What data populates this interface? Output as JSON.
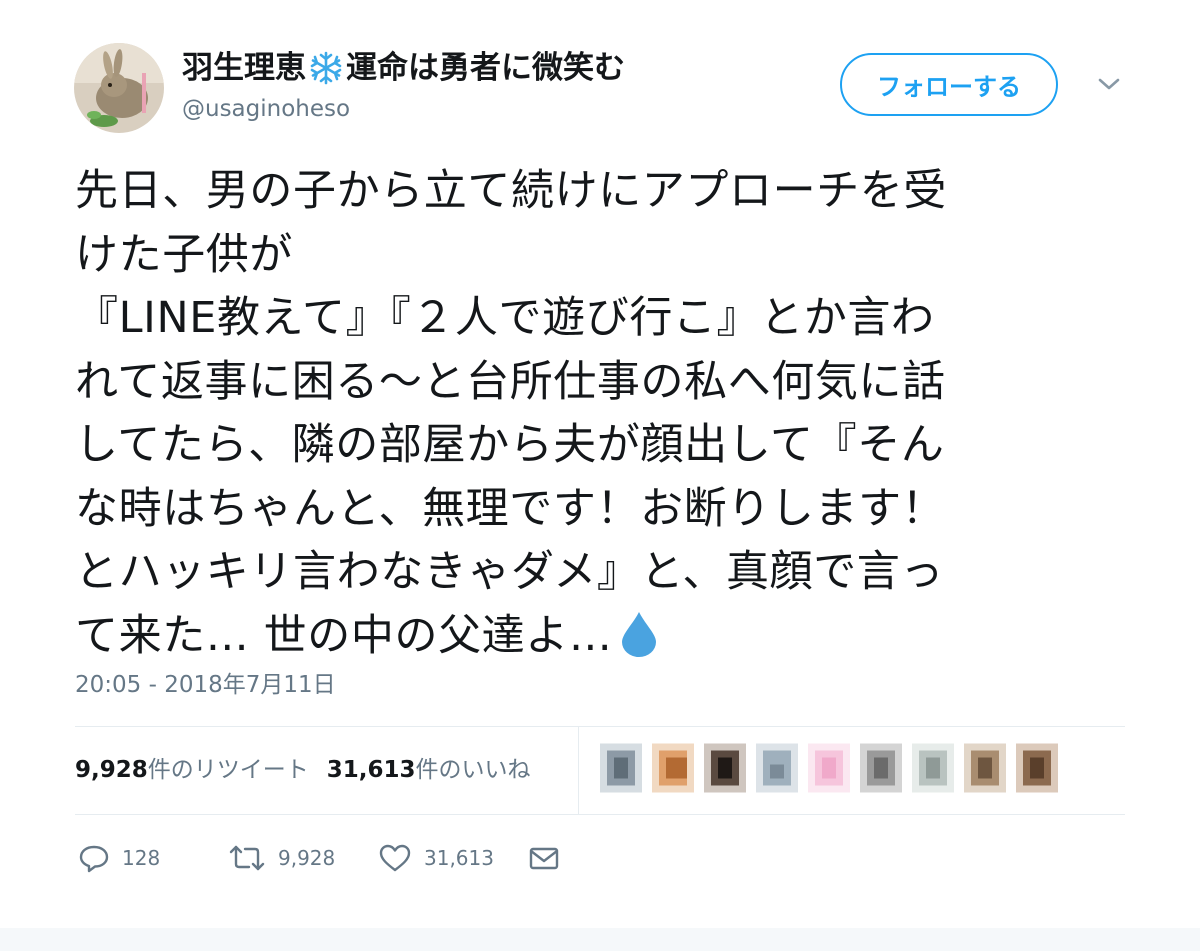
{
  "user": {
    "display_name_part1": "羽生理恵",
    "display_name_part2": "運命は勇者に微笑む",
    "handle": "@usaginoheso"
  },
  "header": {
    "follow_label": "フォローする"
  },
  "tweet": {
    "lines": [
      "先日、男の子から立て続けにアプローチを受",
      "けた子供が",
      "『LINE教えて』『２人で遊び行こ』とか言わ",
      "れて返事に困る～と台所仕事の私へ何気に話",
      "してたら、隣の部屋から夫が顔出して『そん",
      "な時はちゃんと、無理です！お断りします！",
      "とハッキリ言わなきゃダメ』と、真顔で言っ",
      "て来た… 世の中の父達よ…"
    ],
    "timestamp": "20:05 - 2018年7月11日"
  },
  "stats": {
    "retweet_count": "9,928",
    "retweet_suffix": "件のリツイート",
    "like_count": "31,613",
    "like_suffix": "件のいいね"
  },
  "actions": {
    "reply_count": "128",
    "retweet_count": "9,928",
    "like_count": "31,613"
  },
  "colors": {
    "accent": "#1da1f2",
    "secondary_text": "#657786",
    "divider": "#e6ecf0",
    "snowflake": "#3ba9e8",
    "drop": "#4aa3e0"
  },
  "icons": [
    "snowflake-icon",
    "caret-down-icon",
    "water-drop-icon",
    "reply-icon",
    "retweet-icon",
    "like-icon",
    "direct-message-icon"
  ]
}
